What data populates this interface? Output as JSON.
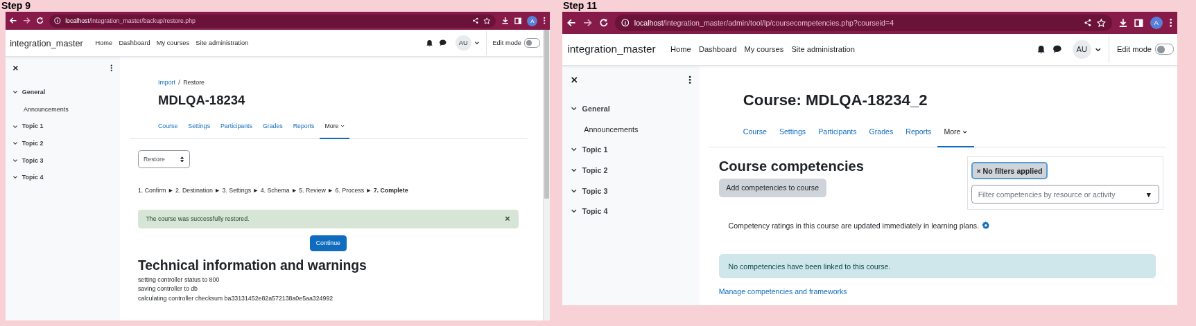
{
  "panels": [
    {
      "caption": "Step 9",
      "browser": {
        "url_host": "localhost",
        "url_path": "/integration_master/backup/restore.php",
        "profile": "A"
      },
      "site": {
        "name": "integration_master",
        "nav": [
          "Home",
          "Dashboard",
          "My courses",
          "Site administration"
        ],
        "user": "AU",
        "edit_mode": {
          "label": "Edit mode",
          "on": false
        }
      },
      "sidebar": [
        {
          "label": "General",
          "expanded": true,
          "children": [
            {
              "label": "Announcements"
            }
          ]
        },
        {
          "label": "Topic 1",
          "expanded": true
        },
        {
          "label": "Topic 2",
          "expanded": true
        },
        {
          "label": "Topic 3",
          "expanded": true
        },
        {
          "label": "Topic 4",
          "expanded": true
        }
      ],
      "page": {
        "kind": "restore",
        "breadcrumb": [
          {
            "label": "Import",
            "link": true
          },
          {
            "label": "Restore",
            "link": false
          }
        ],
        "breadcrumb_separator": "/",
        "heading": "MDLQA-18234",
        "tabs": [
          {
            "label": "Course",
            "selected": false
          },
          {
            "label": "Settings",
            "selected": false
          },
          {
            "label": "Participants",
            "selected": false
          },
          {
            "label": "Grades",
            "selected": false
          },
          {
            "label": "Reports",
            "selected": false
          },
          {
            "label": "More",
            "selected": true,
            "dropdown": true
          }
        ],
        "select": "Restore",
        "steps": "1. Confirm ► 2. Destination ► 3. Settings ► 4. Schema ► 5. Review ► 6. Process ► **7. Complete**",
        "alert": "The course was successfully restored.",
        "button": "Continue",
        "section_heading": "Technical information and warnings",
        "log": [
          "setting controller status to 800",
          "saving controller to db",
          "calculating controller checksum ba33131452e82a572138a0e5aa324992"
        ]
      }
    },
    {
      "caption": "Step 11",
      "browser": {
        "url_host": "localhost",
        "url_path": "/integration_master/admin/tool/lp/coursecompetencies.php?courseid=4",
        "profile": "A"
      },
      "site": {
        "name": "integration_master",
        "nav": [
          "Home",
          "Dashboard",
          "My courses",
          "Site administration"
        ],
        "user": "AU",
        "edit_mode": {
          "label": "Edit mode",
          "on": false
        }
      },
      "sidebar": [
        {
          "label": "General",
          "expanded": true,
          "children": [
            {
              "label": "Announcements"
            }
          ]
        },
        {
          "label": "Topic 1",
          "expanded": true
        },
        {
          "label": "Topic 2",
          "expanded": true
        },
        {
          "label": "Topic 3",
          "expanded": true
        },
        {
          "label": "Topic 4",
          "expanded": true
        }
      ],
      "page": {
        "kind": "competencies",
        "heading": "Course: MDLQA-18234_2",
        "tabs": [
          {
            "label": "Course",
            "selected": false
          },
          {
            "label": "Settings",
            "selected": false
          },
          {
            "label": "Participants",
            "selected": false
          },
          {
            "label": "Grades",
            "selected": false
          },
          {
            "label": "Reports",
            "selected": false
          },
          {
            "label": "More",
            "selected": true,
            "dropdown": true
          }
        ],
        "section_heading": "Course competencies",
        "button": "Add competencies to course",
        "filter": {
          "chip": "× No filters applied",
          "placeholder": "Filter competencies by resource or activity",
          "arrow": "▼"
        },
        "note": "Competency ratings in this course are updated immediately in learning plans.",
        "alert": "No competencies have been linked to this course.",
        "link": "Manage competencies and frameworks"
      }
    }
  ]
}
